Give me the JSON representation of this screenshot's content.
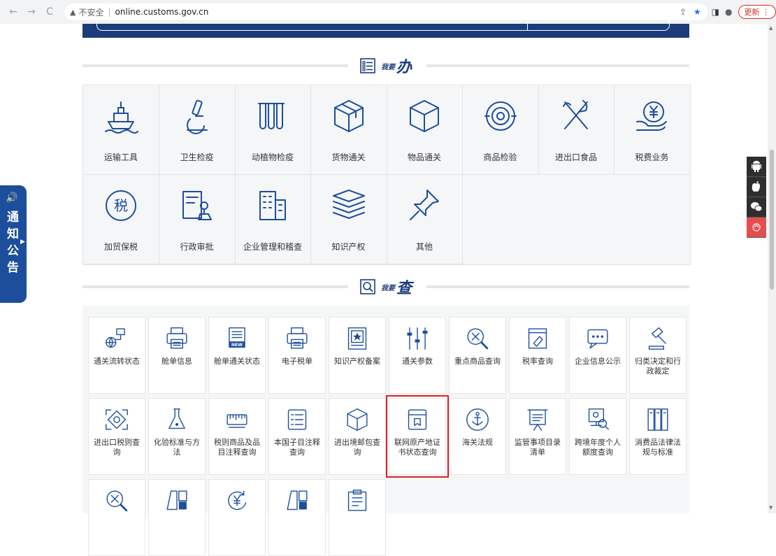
{
  "browser": {
    "nav": [
      "←",
      "→",
      "C"
    ],
    "security_warning": "不安全",
    "url": "online.customs.gov.cn",
    "update_label": "更新"
  },
  "sections": {
    "ban": {
      "small": "我要",
      "big": "办"
    },
    "cha": {
      "small": "我要",
      "big": "查"
    }
  },
  "ban_items": [
    {
      "label": "运输工具",
      "icon": "ship-icon"
    },
    {
      "label": "卫生检疫",
      "icon": "microscope-icon"
    },
    {
      "label": "动植物检疫",
      "icon": "test-tubes-icon"
    },
    {
      "label": "货物通关",
      "icon": "cargo-box-icon"
    },
    {
      "label": "物品通关",
      "icon": "package-icon"
    },
    {
      "label": "商品检验",
      "icon": "inspection-eye-icon"
    },
    {
      "label": "进出口食品",
      "icon": "fork-knife-icon"
    },
    {
      "label": "税费业务",
      "icon": "yuan-hand-icon"
    },
    {
      "label": "加贸保税",
      "icon": "tax-seal-icon"
    },
    {
      "label": "行政审批",
      "icon": "approval-stamp-icon"
    },
    {
      "label": "企业管理和稽查",
      "icon": "building-icon"
    },
    {
      "label": "知识产权",
      "icon": "books-icon"
    },
    {
      "label": "其他",
      "icon": "pin-icon"
    }
  ],
  "cha_items": [
    {
      "label": "通关流转状态",
      "icon": "globe-flow-icon"
    },
    {
      "label": "舱单信息",
      "icon": "printer-icon"
    },
    {
      "label": "舱单通关状态",
      "icon": "new-document-icon"
    },
    {
      "label": "电子税单",
      "icon": "printer-icon"
    },
    {
      "label": "知识产权备案",
      "icon": "star-document-icon"
    },
    {
      "label": "通关参数",
      "icon": "sliders-icon"
    },
    {
      "label": "重点商品查询",
      "icon": "search-cross-icon"
    },
    {
      "label": "税率查询",
      "icon": "tag-document-icon"
    },
    {
      "label": "企业信息公示",
      "icon": "chat-bubble-icon"
    },
    {
      "label": "归类决定和行政裁定",
      "icon": "gavel-icon"
    },
    {
      "label": "进出口税则查询",
      "icon": "scan-card-icon"
    },
    {
      "label": "化验标准与方法",
      "icon": "flask-icon"
    },
    {
      "label": "税则商品及品目注释查询",
      "icon": "ruler-icon"
    },
    {
      "label": "本国子目注释查询",
      "icon": "list-document-icon"
    },
    {
      "label": "进出境邮包查询",
      "icon": "parcel-icon"
    },
    {
      "label": "联网原产地证书状态查询",
      "icon": "certificate-icon"
    },
    {
      "label": "海关法规",
      "icon": "anchor-icon"
    },
    {
      "label": "监管事项目录清单",
      "icon": "easel-icon"
    },
    {
      "label": "跨境年度个人额度查询",
      "icon": "monitor-search-icon"
    },
    {
      "label": "消费品法律法规与标准",
      "icon": "binders-icon"
    },
    {
      "label": "",
      "icon": "search-cross-icon"
    },
    {
      "label": "",
      "icon": "split-panel-icon"
    },
    {
      "label": "",
      "icon": "yuan-refresh-icon"
    },
    {
      "label": "",
      "icon": "split-panel-icon"
    },
    {
      "label": "",
      "icon": "clipboard-icon"
    }
  ],
  "notice": {
    "text": "通知公告"
  },
  "colors": {
    "accent": "#1c3d7a",
    "highlight": "#e02020",
    "icon_blue": "#1c4e9c"
  }
}
